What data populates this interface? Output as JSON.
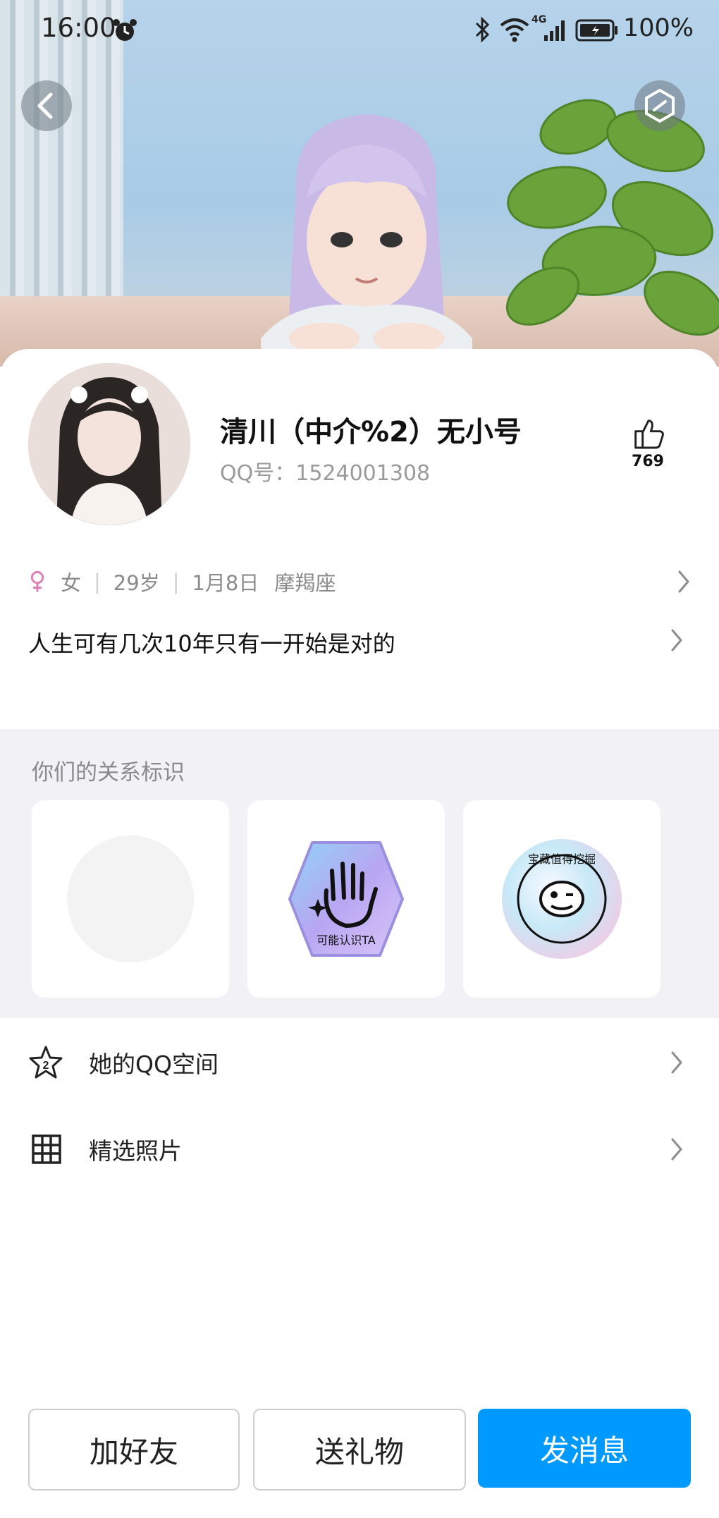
{
  "status_bar": {
    "time": "16:00",
    "network": "4G",
    "battery": "100%"
  },
  "profile": {
    "nickname": "清川（中介%2）无小号",
    "qq_number": "QQ号：1524001308",
    "likes": "769",
    "gender_icon": "female-icon",
    "gender": "女",
    "age": "29岁",
    "birthday": "1月8日",
    "zodiac": "摩羯座",
    "signature": "人生可有几次10年只有一开始是对的"
  },
  "relation": {
    "title": "你们的关系标识",
    "badges": [
      {
        "label": "",
        "icon": "empty-badge-icon"
      },
      {
        "label": "可能认识TA",
        "icon": "waving-hand-badge-icon"
      },
      {
        "label": "宝藏值得挖掘",
        "icon": "treasure-smiley-badge-icon"
      }
    ]
  },
  "list": [
    {
      "label": "她的QQ空间",
      "icon": "star-2-icon"
    },
    {
      "label": "精选照片",
      "icon": "grid-icon"
    }
  ],
  "buttons": {
    "add_friend": "加好友",
    "send_gift": "送礼物",
    "send_message": "发消息"
  },
  "colors": {
    "primary": "#0099ff",
    "gender_female": "#e07fb6",
    "section_bg": "#f2f2f6"
  }
}
